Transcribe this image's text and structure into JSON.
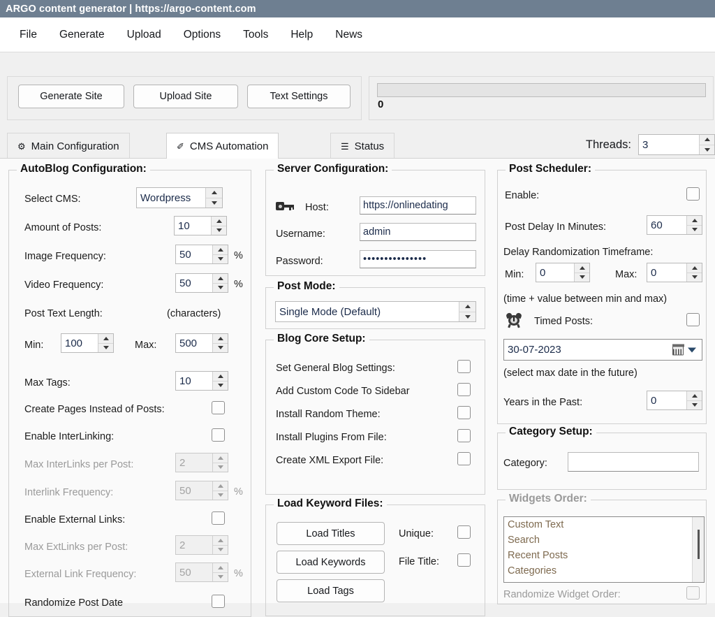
{
  "window": {
    "title": "ARGO content generator |  https://argo-content.com"
  },
  "menubar": {
    "items": [
      {
        "label": "File"
      },
      {
        "label": "Generate"
      },
      {
        "label": "Upload"
      },
      {
        "label": "Options"
      },
      {
        "label": "Tools"
      },
      {
        "label": "Help"
      },
      {
        "label": "News"
      }
    ]
  },
  "toolbar": {
    "generate_site": "Generate Site",
    "upload_site": "Upload Site",
    "text_settings": "Text Settings",
    "progress_value": "0"
  },
  "tabs": {
    "items": [
      {
        "label": "Main Configuration",
        "icon": "gear-icon",
        "glyph": "⚙",
        "active": false
      },
      {
        "label": "CMS Automation",
        "icon": "pencil-icon",
        "glyph": "✐",
        "active": true
      },
      {
        "label": "Status",
        "icon": "list-icon",
        "glyph": "☰",
        "active": false
      }
    ],
    "threads_label": "Threads:",
    "threads_value": "3"
  },
  "autoblog": {
    "title": "AutoBlog Configuration:",
    "select_cms_label": "Select CMS:",
    "select_cms_value": "Wordpress",
    "amount_posts_label": "Amount of Posts:",
    "amount_posts_value": "10",
    "image_freq_label": "Image Frequency:",
    "image_freq_value": "50",
    "image_freq_unit": "%",
    "video_freq_label": "Video Frequency:",
    "video_freq_value": "50",
    "video_freq_unit": "%",
    "post_text_length_label": "Post Text Length:",
    "post_text_length_hint": "(characters)",
    "min_label": "Min:",
    "min_value": "100",
    "max_label": "Max:",
    "max_value": "500",
    "max_tags_label": "Max Tags:",
    "max_tags_value": "10",
    "create_pages_label": "Create Pages Instead of Posts:",
    "enable_interlinking_label": "Enable InterLinking:",
    "max_interlinks_label": "Max InterLinks per Post:",
    "max_interlinks_value": "2",
    "interlink_freq_label": "Interlink Frequency:",
    "interlink_freq_value": "50",
    "interlink_freq_unit": "%",
    "enable_extlinks_label": "Enable External Links:",
    "max_extlinks_label": "Max ExtLinks per Post:",
    "max_extlinks_value": "2",
    "ext_link_freq_label": "External Link Frequency:",
    "ext_link_freq_value": "50",
    "ext_link_freq_unit": "%",
    "randomize_post_date_label": "Randomize Post Date"
  },
  "server": {
    "title": "Server Configuration:",
    "host_label": "Host:",
    "host_value": "https://onlinedating",
    "username_label": "Username:",
    "username_value": "admin",
    "password_label": "Password:",
    "password_value": "•••••••••••••••"
  },
  "postmode": {
    "title": "Post Mode:",
    "value": "Single Mode (Default)"
  },
  "blogcore": {
    "title": "Blog Core Setup:",
    "items": [
      {
        "label": "Set General Blog Settings:"
      },
      {
        "label": "Add Custom Code To Sidebar"
      },
      {
        "label": "Install Random Theme:"
      },
      {
        "label": "Install Plugins From File:"
      },
      {
        "label": "Create XML Export File:"
      }
    ]
  },
  "keywordfiles": {
    "title": "Load Keyword Files:",
    "load_titles": "Load Titles",
    "load_keywords": "Load Keywords",
    "load_tags": "Load Tags",
    "unique_label": "Unique:",
    "filetitle_label": "File Title:"
  },
  "scheduler": {
    "title": "Post Scheduler:",
    "enable_label": "Enable:",
    "post_delay_label": "Post Delay In Minutes:",
    "post_delay_value": "60",
    "delay_random_label": "Delay Randomization Timeframe:",
    "min_label": "Min:",
    "min_value": "0",
    "max_label": "Max:",
    "max_value": "0",
    "hint": "(time + value between min and max)",
    "timed_posts_label": "Timed Posts:",
    "date_value": "30-07-2023",
    "date_hint": "(select max date in the future)",
    "years_past_label": "Years in the Past:",
    "years_past_value": "0"
  },
  "category": {
    "title": "Category Setup:",
    "label": "Category:",
    "value": ""
  },
  "widgets": {
    "title": "Widgets Order:",
    "items": [
      "Custom Text",
      "Search",
      "Recent Posts",
      "Categories"
    ],
    "randomize_label": "Randomize Widget Order:"
  }
}
